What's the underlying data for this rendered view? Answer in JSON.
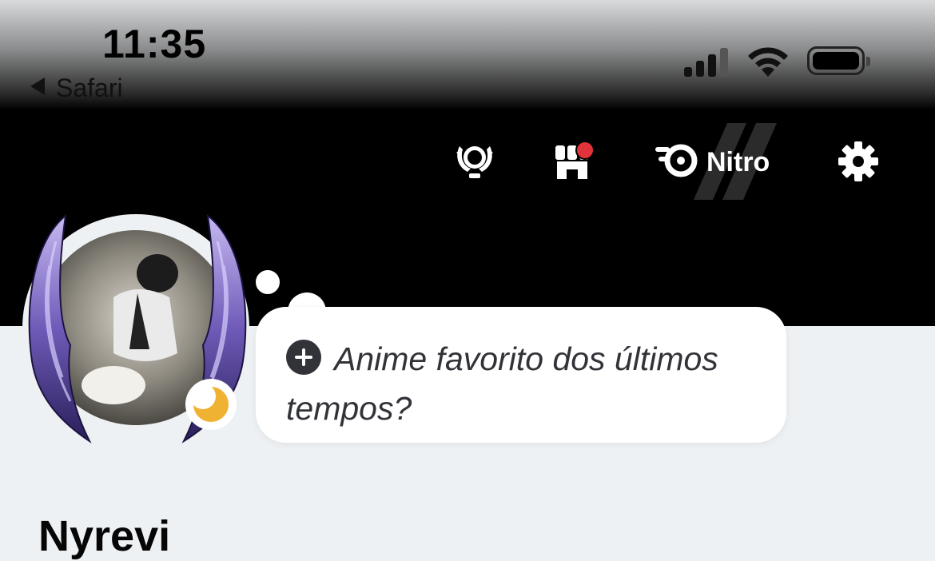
{
  "status_bar": {
    "time": "11:35",
    "back_label": "Safari",
    "icons": [
      "cellular-signal-icon",
      "wifi-icon",
      "battery-icon"
    ]
  },
  "header": {
    "buttons": [
      {
        "name": "quests",
        "icon": "laurel-icon"
      },
      {
        "name": "shop",
        "icon": "shop-icon",
        "has_notification": true
      },
      {
        "name": "nitro",
        "icon": "nitro-icon",
        "label": "Nitro"
      },
      {
        "name": "settings",
        "icon": "gear-icon"
      }
    ]
  },
  "profile": {
    "status_icon": "moon-icon",
    "custom_status_placeholder": "Anime favorito dos últimos tempos?",
    "username": "Nyrevi"
  },
  "colors": {
    "notification": "#e0333a",
    "idle_status": "#f0b232",
    "banner": "#000000",
    "page_bg": "#eef1f3",
    "wing_purple": "#6f5bb8"
  }
}
